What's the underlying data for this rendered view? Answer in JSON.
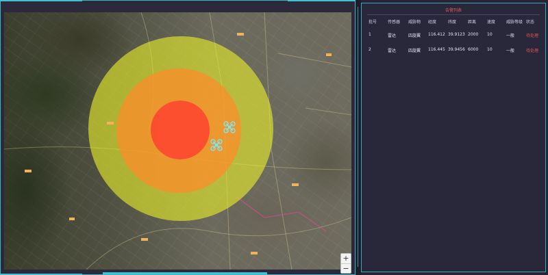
{
  "map": {
    "zones": {
      "outer_color": "#e6ee2a",
      "middle_color": "#ff8a2a",
      "inner_color": "#ff3b2f"
    },
    "zoom_in_label": "+",
    "zoom_out_label": "−"
  },
  "alarm_list": {
    "title": "告警列表",
    "columns": [
      "批号",
      "传感器",
      "威胁物",
      "经度",
      "纬度",
      "距离",
      "速度",
      "威胁等级",
      "状态"
    ],
    "rows": [
      [
        "1",
        "雷达",
        "四旋翼",
        "116.412",
        "39.9123",
        "2000",
        "10",
        "一般",
        "待处理"
      ],
      [
        "2",
        "雷达",
        "四旋翼",
        "116.445",
        "39.9456",
        "6000",
        "10",
        "一般",
        "待处理"
      ]
    ],
    "status_color": "#e55353"
  }
}
